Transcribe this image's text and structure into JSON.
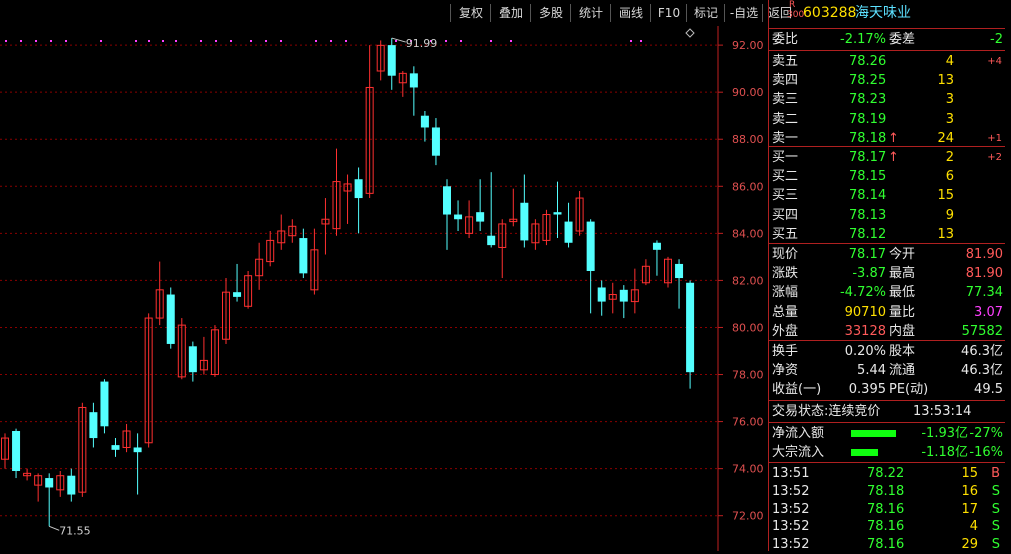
{
  "toolbar": {
    "buttons": [
      "复权",
      "叠加",
      "多股",
      "统计",
      "画线",
      "F10",
      "标记",
      "-自选",
      "返回"
    ]
  },
  "stock": {
    "index_badge_top": "R",
    "index_badge_bottom": "300",
    "code": "603288",
    "name": "海天味业"
  },
  "colors": {
    "up": "#ff3030",
    "down": "#54ffff",
    "grid": "#8a0000",
    "axis": "#c02020"
  },
  "chart_data": {
    "type": "candlestick",
    "ylim": [
      70.5,
      92.6
    ],
    "yticks": [
      "92.00",
      "90.00",
      "88.00",
      "86.00",
      "84.00",
      "82.00",
      "80.00",
      "78.00",
      "76.00",
      "74.00",
      "72.00"
    ],
    "high_label": "91.99",
    "low_label": "71.55",
    "candles": [
      {
        "o": 74.4,
        "c": 75.3,
        "h": 75.5,
        "l": 74.0
      },
      {
        "o": 75.6,
        "c": 73.9,
        "h": 75.7,
        "l": 73.6
      },
      {
        "o": 73.7,
        "c": 73.8,
        "h": 74.0,
        "l": 73.5
      },
      {
        "o": 73.3,
        "c": 73.7,
        "h": 73.8,
        "l": 72.6
      },
      {
        "o": 73.6,
        "c": 73.2,
        "h": 73.8,
        "l": 71.55
      },
      {
        "o": 73.1,
        "c": 73.7,
        "h": 73.9,
        "l": 72.8
      },
      {
        "o": 73.7,
        "c": 72.9,
        "h": 74.0,
        "l": 72.6
      },
      {
        "o": 73.0,
        "c": 76.6,
        "h": 76.8,
        "l": 72.8
      },
      {
        "o": 76.4,
        "c": 75.3,
        "h": 76.8,
        "l": 74.9
      },
      {
        "o": 77.7,
        "c": 75.8,
        "h": 77.8,
        "l": 75.5
      },
      {
        "o": 75.0,
        "c": 74.8,
        "h": 75.3,
        "l": 74.5
      },
      {
        "o": 74.9,
        "c": 75.6,
        "h": 75.9,
        "l": 74.7
      },
      {
        "o": 74.9,
        "c": 74.7,
        "h": 75.5,
        "l": 72.9
      },
      {
        "o": 75.1,
        "c": 80.4,
        "h": 80.6,
        "l": 74.9
      },
      {
        "o": 80.4,
        "c": 81.6,
        "h": 82.8,
        "l": 80.1
      },
      {
        "o": 81.4,
        "c": 79.3,
        "h": 81.7,
        "l": 79.1
      },
      {
        "o": 77.9,
        "c": 80.1,
        "h": 80.4,
        "l": 77.8
      },
      {
        "o": 79.2,
        "c": 78.1,
        "h": 79.4,
        "l": 77.7
      },
      {
        "o": 78.2,
        "c": 78.6,
        "h": 79.6,
        "l": 78.0
      },
      {
        "o": 78.0,
        "c": 79.9,
        "h": 80.1,
        "l": 77.9
      },
      {
        "o": 79.5,
        "c": 81.5,
        "h": 82.1,
        "l": 79.3
      },
      {
        "o": 81.5,
        "c": 81.3,
        "h": 82.7,
        "l": 81.1
      },
      {
        "o": 80.9,
        "c": 82.2,
        "h": 82.4,
        "l": 80.8
      },
      {
        "o": 82.2,
        "c": 82.9,
        "h": 83.6,
        "l": 81.6
      },
      {
        "o": 82.8,
        "c": 83.7,
        "h": 84.1,
        "l": 82.6
      },
      {
        "o": 83.6,
        "c": 84.1,
        "h": 84.8,
        "l": 83.3
      },
      {
        "o": 83.9,
        "c": 84.3,
        "h": 84.6,
        "l": 83.6
      },
      {
        "o": 83.8,
        "c": 82.3,
        "h": 84.2,
        "l": 82.1
      },
      {
        "o": 81.6,
        "c": 83.3,
        "h": 84.2,
        "l": 81.4
      },
      {
        "o": 84.4,
        "c": 84.6,
        "h": 85.5,
        "l": 83.1
      },
      {
        "o": 84.2,
        "c": 86.2,
        "h": 87.6,
        "l": 83.9
      },
      {
        "o": 85.8,
        "c": 86.1,
        "h": 86.5,
        "l": 84.4
      },
      {
        "o": 86.3,
        "c": 85.5,
        "h": 86.8,
        "l": 84.0
      },
      {
        "o": 85.7,
        "c": 90.2,
        "h": 92.0,
        "l": 85.5
      },
      {
        "o": 90.9,
        "c": 91.99,
        "h": 92.2,
        "l": 90.5
      },
      {
        "o": 92.0,
        "c": 90.7,
        "h": 92.3,
        "l": 90.1
      },
      {
        "o": 90.4,
        "c": 90.8,
        "h": 90.9,
        "l": 89.8
      },
      {
        "o": 90.8,
        "c": 90.2,
        "h": 91.1,
        "l": 89.0
      },
      {
        "o": 89.0,
        "c": 88.5,
        "h": 89.2,
        "l": 87.9
      },
      {
        "o": 88.5,
        "c": 87.3,
        "h": 88.9,
        "l": 86.9
      },
      {
        "o": 86.0,
        "c": 84.8,
        "h": 86.3,
        "l": 83.3
      },
      {
        "o": 84.8,
        "c": 84.6,
        "h": 85.4,
        "l": 84.1
      },
      {
        "o": 84.0,
        "c": 84.7,
        "h": 85.4,
        "l": 83.8
      },
      {
        "o": 84.9,
        "c": 84.5,
        "h": 86.3,
        "l": 84.1
      },
      {
        "o": 83.9,
        "c": 83.5,
        "h": 86.6,
        "l": 83.4
      },
      {
        "o": 83.4,
        "c": 84.4,
        "h": 84.6,
        "l": 82.1
      },
      {
        "o": 84.5,
        "c": 84.6,
        "h": 85.9,
        "l": 84.3
      },
      {
        "o": 85.3,
        "c": 83.7,
        "h": 86.5,
        "l": 83.4
      },
      {
        "o": 83.6,
        "c": 84.4,
        "h": 84.6,
        "l": 83.3
      },
      {
        "o": 83.7,
        "c": 84.8,
        "h": 85.0,
        "l": 83.5
      },
      {
        "o": 84.9,
        "c": 84.8,
        "h": 86.2,
        "l": 83.8
      },
      {
        "o": 84.5,
        "c": 83.6,
        "h": 85.3,
        "l": 83.4
      },
      {
        "o": 84.1,
        "c": 85.5,
        "h": 85.8,
        "l": 83.9
      },
      {
        "o": 84.5,
        "c": 82.4,
        "h": 84.6,
        "l": 80.6
      },
      {
        "o": 81.7,
        "c": 81.1,
        "h": 82.0,
        "l": 80.5
      },
      {
        "o": 81.2,
        "c": 81.4,
        "h": 81.9,
        "l": 80.6
      },
      {
        "o": 81.6,
        "c": 81.1,
        "h": 81.8,
        "l": 80.4
      },
      {
        "o": 81.1,
        "c": 81.6,
        "h": 82.5,
        "l": 80.6
      },
      {
        "o": 81.9,
        "c": 82.6,
        "h": 82.9,
        "l": 81.8
      },
      {
        "o": 83.6,
        "c": 83.3,
        "h": 83.7,
        "l": 82.2
      },
      {
        "o": 81.9,
        "c": 82.9,
        "h": 83.0,
        "l": 81.7
      },
      {
        "o": 82.7,
        "c": 82.1,
        "h": 82.9,
        "l": 80.8
      },
      {
        "o": 81.9,
        "c": 78.1,
        "h": 82.0,
        "l": 77.4
      }
    ]
  },
  "quote": {
    "weibi_label": "委比",
    "weibi": "-2.17%",
    "weicha_label": "委差",
    "weicha": "-2",
    "asks": [
      {
        "label": "卖五",
        "price": "78.26",
        "vol": "4",
        "chg": "+4"
      },
      {
        "label": "卖四",
        "price": "78.25",
        "vol": "13",
        "chg": ""
      },
      {
        "label": "卖三",
        "price": "78.23",
        "vol": "3",
        "chg": ""
      },
      {
        "label": "卖二",
        "price": "78.19",
        "vol": "3",
        "chg": ""
      },
      {
        "label": "卖一",
        "price": "78.18",
        "vol": "24",
        "chg": "+1",
        "arrow": "↑"
      }
    ],
    "bids": [
      {
        "label": "买一",
        "price": "78.17",
        "vol": "2",
        "chg": "+2",
        "arrow": "↑"
      },
      {
        "label": "买二",
        "price": "78.15",
        "vol": "6",
        "chg": ""
      },
      {
        "label": "买三",
        "price": "78.14",
        "vol": "15",
        "chg": ""
      },
      {
        "label": "买四",
        "price": "78.13",
        "vol": "9",
        "chg": ""
      },
      {
        "label": "买五",
        "price": "78.12",
        "vol": "13",
        "chg": ""
      }
    ],
    "stats": [
      {
        "l1": "现价",
        "v1": "78.17",
        "c1": "green",
        "l2": "今开",
        "v2": "81.90",
        "c2": "red"
      },
      {
        "l1": "涨跌",
        "v1": "-3.87",
        "c1": "green",
        "l2": "最高",
        "v2": "81.90",
        "c2": "red"
      },
      {
        "l1": "涨幅",
        "v1": "-4.72%",
        "c1": "green",
        "l2": "最低",
        "v2": "77.34",
        "c2": "green"
      },
      {
        "l1": "总量",
        "v1": "90710",
        "c1": "yellow",
        "l2": "量比",
        "v2": "3.07",
        "c2": "magenta"
      },
      {
        "l1": "外盘",
        "v1": "33128",
        "c1": "red",
        "l2": "内盘",
        "v2": "57582",
        "c2": "green"
      }
    ],
    "fundamentals": [
      {
        "l1": "换手",
        "v1": "0.20%",
        "l2": "股本",
        "v2": "46.3亿"
      },
      {
        "l1": "净资",
        "v1": "5.44",
        "l2": "流通",
        "v2": "46.3亿"
      },
      {
        "l1": "收益(一)",
        "v1": "0.395",
        "l2": "PE(动)",
        "v2": "49.5"
      }
    ],
    "trade_status": "交易状态:连续竞价",
    "trade_time": "13:53:14",
    "flows": [
      {
        "label": "净流入额",
        "value": "-1.93亿",
        "pct": "-27%",
        "fill": 0.27
      },
      {
        "label": "大宗流入",
        "value": "-1.18亿",
        "pct": "-16%",
        "fill": 0.16
      }
    ],
    "ticks": [
      {
        "time": "13:51",
        "price": "78.22",
        "vol": "15",
        "side": "B"
      },
      {
        "time": "13:52",
        "price": "78.18",
        "vol": "16",
        "side": "S"
      },
      {
        "time": "13:52",
        "price": "78.16",
        "vol": "17",
        "side": "S"
      },
      {
        "time": "13:52",
        "price": "78.16",
        "vol": "4",
        "side": "S"
      },
      {
        "time": "13:52",
        "price": "78.16",
        "vol": "29",
        "side": "S"
      }
    ]
  }
}
